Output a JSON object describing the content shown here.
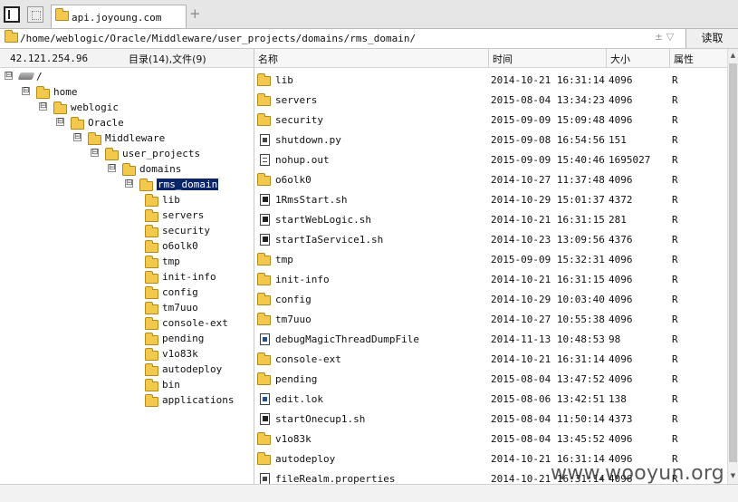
{
  "tab": {
    "label": "api.joyoung.com",
    "new_tab": "+"
  },
  "address": {
    "path": "/home/weblogic/Oracle/Middleware/user_projects/domains/rms_domain/",
    "controls": "± ▽",
    "read_button": "读取"
  },
  "left_panel": {
    "ip": "42.121.254.96",
    "counts": "目录(14),文件(9)",
    "tree": [
      {
        "label": "/",
        "depth": 0,
        "icon": "drive-icon",
        "toggle": "⊟"
      },
      {
        "label": "home",
        "depth": 1,
        "icon": "folder-icon",
        "toggle": "⊟"
      },
      {
        "label": "weblogic",
        "depth": 2,
        "icon": "folder-icon",
        "toggle": "⊟"
      },
      {
        "label": "Oracle",
        "depth": 3,
        "icon": "folder-icon",
        "toggle": "⊟"
      },
      {
        "label": "Middleware",
        "depth": 4,
        "icon": "folder-icon",
        "toggle": "⊟"
      },
      {
        "label": "user_projects",
        "depth": 5,
        "icon": "folder-icon",
        "toggle": "⊟"
      },
      {
        "label": "domains",
        "depth": 6,
        "icon": "folder-icon",
        "toggle": "⊟"
      },
      {
        "label": "rms_domain",
        "depth": 7,
        "icon": "folder-icon",
        "toggle": "⊟",
        "selected": true
      },
      {
        "label": "lib",
        "depth": 8,
        "icon": "folder-icon"
      },
      {
        "label": "servers",
        "depth": 8,
        "icon": "folder-icon"
      },
      {
        "label": "security",
        "depth": 8,
        "icon": "folder-icon"
      },
      {
        "label": "o6olk0",
        "depth": 8,
        "icon": "folder-icon"
      },
      {
        "label": "tmp",
        "depth": 8,
        "icon": "folder-icon"
      },
      {
        "label": "init-info",
        "depth": 8,
        "icon": "folder-icon"
      },
      {
        "label": "config",
        "depth": 8,
        "icon": "folder-icon"
      },
      {
        "label": "tm7uuo",
        "depth": 8,
        "icon": "folder-icon"
      },
      {
        "label": "console-ext",
        "depth": 8,
        "icon": "folder-icon"
      },
      {
        "label": "pending",
        "depth": 8,
        "icon": "folder-icon"
      },
      {
        "label": "v1o83k",
        "depth": 8,
        "icon": "folder-icon"
      },
      {
        "label": "autodeploy",
        "depth": 8,
        "icon": "folder-icon"
      },
      {
        "label": "bin",
        "depth": 8,
        "icon": "folder-icon"
      },
      {
        "label": "applications",
        "depth": 8,
        "icon": "folder-icon"
      }
    ]
  },
  "file_list": {
    "columns": {
      "name": "名称",
      "time": "时间",
      "size": "大小",
      "attr": "属性"
    },
    "rows": [
      {
        "name": "lib",
        "time": "2014-10-21 16:31:14",
        "size": "4096",
        "attr": "R",
        "icon": "folder-icon"
      },
      {
        "name": "servers",
        "time": "2015-08-04 13:34:23",
        "size": "4096",
        "attr": "R",
        "icon": "folder-icon"
      },
      {
        "name": "security",
        "time": "2015-09-09 15:09:48",
        "size": "4096",
        "attr": "R",
        "icon": "folder-icon"
      },
      {
        "name": "shutdown.py",
        "time": "2015-09-08 16:54:56",
        "size": "151",
        "attr": "R",
        "icon": "file-icon"
      },
      {
        "name": "nohup.out",
        "time": "2015-09-09 15:40:46",
        "size": "1695027",
        "attr": "R",
        "icon": "text-file-icon"
      },
      {
        "name": "o6olk0",
        "time": "2014-10-27 11:37:48",
        "size": "4096",
        "attr": "R",
        "icon": "folder-icon"
      },
      {
        "name": "1RmsStart.sh",
        "time": "2014-10-29 15:01:37",
        "size": "4372",
        "attr": "R",
        "icon": "script-icon"
      },
      {
        "name": "startWebLogic.sh",
        "time": "2014-10-21 16:31:15",
        "size": "281",
        "attr": "R",
        "icon": "script-icon"
      },
      {
        "name": "startIaService1.sh",
        "time": "2014-10-23 13:09:56",
        "size": "4376",
        "attr": "R",
        "icon": "script-icon"
      },
      {
        "name": "tmp",
        "time": "2015-09-09 15:32:31",
        "size": "4096",
        "attr": "R",
        "icon": "folder-icon"
      },
      {
        "name": "init-info",
        "time": "2014-10-21 16:31:15",
        "size": "4096",
        "attr": "R",
        "icon": "folder-icon"
      },
      {
        "name": "config",
        "time": "2014-10-29 10:03:40",
        "size": "4096",
        "attr": "R",
        "icon": "folder-icon"
      },
      {
        "name": "tm7uuo",
        "time": "2014-10-27 10:55:38",
        "size": "4096",
        "attr": "R",
        "icon": "folder-icon"
      },
      {
        "name": "debugMagicThreadDumpFile",
        "time": "2014-11-13 10:48:53",
        "size": "98",
        "attr": "R",
        "icon": "exe-file-icon"
      },
      {
        "name": "console-ext",
        "time": "2014-10-21 16:31:14",
        "size": "4096",
        "attr": "R",
        "icon": "folder-icon"
      },
      {
        "name": "pending",
        "time": "2015-08-04 13:47:52",
        "size": "4096",
        "attr": "R",
        "icon": "folder-icon"
      },
      {
        "name": "edit.lok",
        "time": "2015-08-06 13:42:51",
        "size": "138",
        "attr": "R",
        "icon": "exe-file-icon"
      },
      {
        "name": "startOnecup1.sh",
        "time": "2015-08-04 11:50:14",
        "size": "4373",
        "attr": "R",
        "icon": "script-icon"
      },
      {
        "name": "v1o83k",
        "time": "2015-08-04 13:45:52",
        "size": "4096",
        "attr": "R",
        "icon": "folder-icon"
      },
      {
        "name": "autodeploy",
        "time": "2014-10-21 16:31:14",
        "size": "4096",
        "attr": "R",
        "icon": "folder-icon"
      },
      {
        "name": "fileRealm.properties",
        "time": "2014-10-21 16:31:14",
        "size": "4096",
        "attr": "R",
        "icon": "file-icon"
      }
    ]
  },
  "watermark": "www.wooyun.org"
}
